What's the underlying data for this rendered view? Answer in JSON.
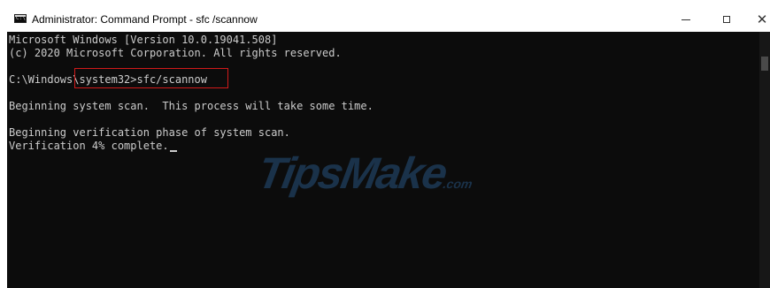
{
  "window": {
    "title": "Administrator: Command Prompt - sfc /scannow",
    "app_icon_label": "C:\\"
  },
  "console": {
    "lines": [
      "Microsoft Windows [Version 10.0.19041.508]",
      "(c) 2020 Microsoft Corporation. All rights reserved.",
      "C:\\Windows\\system32>sfc/scannow",
      "Beginning system scan.  This process will take some time.",
      "Beginning verification phase of system scan.",
      "Verification 4% complete."
    ]
  },
  "watermark": {
    "text": "TipsMake",
    "suffix": ".com"
  }
}
